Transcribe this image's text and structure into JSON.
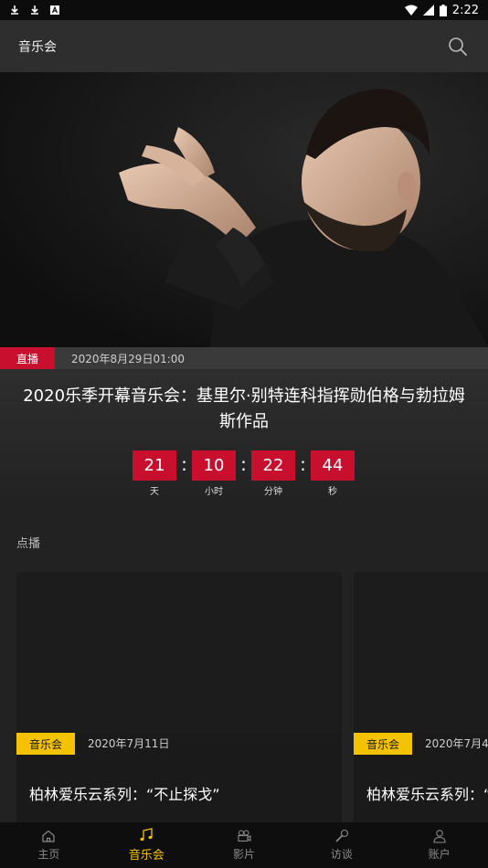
{
  "status_bar": {
    "time": "2:22"
  },
  "header": {
    "title": "音乐会"
  },
  "live": {
    "badge": "直播",
    "datetime": "2020年8月29日01:00",
    "title": "2020乐季开幕音乐会：基里尔·别特连科指挥勋伯格与勃拉姆斯作品",
    "countdown": [
      {
        "value": "21",
        "label": "天"
      },
      {
        "value": "10",
        "label": "小时"
      },
      {
        "value": "22",
        "label": "分钟"
      },
      {
        "value": "44",
        "label": "秒"
      }
    ]
  },
  "on_demand": {
    "section_title": "点播",
    "cards": [
      {
        "badge": "音乐会",
        "date": "2020年7月11日",
        "title": "柏林爱乐云系列：“不止探戈”"
      },
      {
        "badge": "音乐会",
        "date": "2020年7月4",
        "title": "柏林爱乐云系列：“"
      }
    ]
  },
  "tabs": [
    {
      "label": "主页",
      "icon": "home-icon",
      "active": false
    },
    {
      "label": "音乐会",
      "icon": "music-note-icon",
      "active": true
    },
    {
      "label": "影片",
      "icon": "film-camera-icon",
      "active": false
    },
    {
      "label": "访谈",
      "icon": "microphone-icon",
      "active": false
    },
    {
      "label": "账户",
      "icon": "user-icon",
      "active": false
    }
  ],
  "colors": {
    "live_red": "#c8102e",
    "accent_yellow": "#f5c200",
    "background": "#1a1a1a"
  }
}
